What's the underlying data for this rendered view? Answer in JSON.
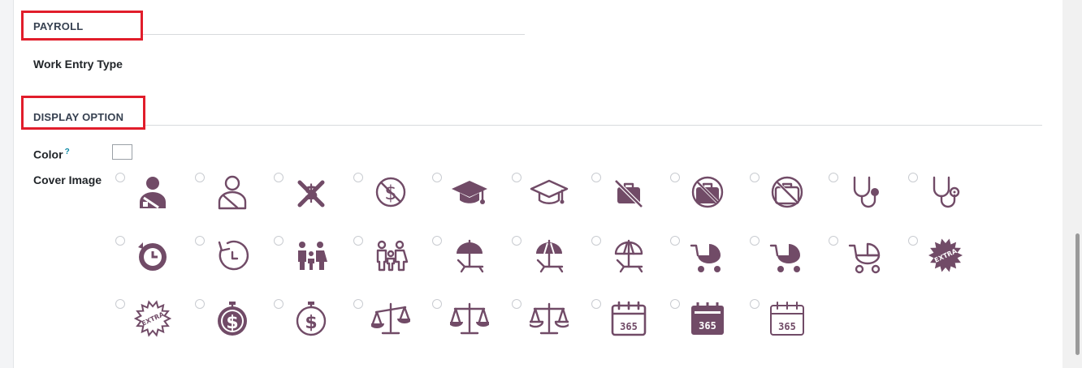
{
  "payroll": {
    "title": "PAYROLL",
    "work_entry_type_label": "Work Entry Type"
  },
  "display": {
    "title": "DISPLAY OPTION",
    "color_label": "Color",
    "color_help": "?",
    "cover_image_label": "Cover Image"
  },
  "colors": {
    "icon": "#714B67",
    "highlight": "#e11d2b",
    "help": "#0d8aa6"
  },
  "cover_images": [
    "injured-person-filled-icon",
    "injured-person-outline-icon",
    "no-money-filled-icon",
    "no-money-outline-icon",
    "graduation-cap-filled-icon",
    "graduation-cap-outline-icon",
    "no-briefcase-icon",
    "no-briefcase-circle-filled-icon",
    "no-briefcase-circle-outline-icon",
    "stethoscope-filled-icon",
    "stethoscope-outline-icon",
    "timer-reset-filled-icon",
    "timer-reset-outline-icon",
    "family-filled-icon",
    "family-outline-icon",
    "beach-umbrella-filled-icon",
    "beach-umbrella-striped-icon",
    "beach-umbrella-outline-icon",
    "baby-stroller-icon",
    "baby-stroller-filled-icon",
    "baby-stroller-outline-icon",
    "extra-badge-filled-icon",
    "extra-badge-outline-icon",
    "dollar-stopwatch-filled-icon",
    "dollar-stopwatch-outline-icon",
    "scales-left-icon",
    "scales-balanced-icon",
    "scales-outline-icon",
    "calendar-365-outline-icon",
    "calendar-365-filled-icon",
    "calendar-365-light-icon"
  ],
  "calendar_text": "365",
  "extra_text": "EXTRA"
}
